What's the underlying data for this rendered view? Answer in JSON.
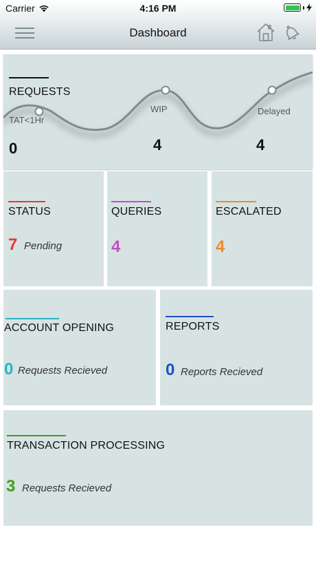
{
  "status_bar": {
    "carrier": "Carrier",
    "time": "4:16 PM"
  },
  "nav": {
    "title": "Dashboard",
    "menu_icon": "hamburger-menu-icon",
    "home_icon": "home-icon",
    "bell_icon": "bell-icon"
  },
  "requests": {
    "title": "REQUESTS",
    "stages": [
      {
        "label": "TAT<1Hr",
        "count": "0"
      },
      {
        "label": "WIP",
        "count": "4"
      },
      {
        "label": "Delayed",
        "count": "4"
      }
    ]
  },
  "status": {
    "title": "STATUS",
    "count": "7",
    "caption": "Pending",
    "accent": "#e53935"
  },
  "queries": {
    "title": "QUERIES",
    "count": "4",
    "accent": "#c24fc7"
  },
  "escalated": {
    "title": "ESCALATED",
    "count": "4",
    "accent": "#f08a24"
  },
  "account_opening": {
    "title": "ACCOUNT OPENING",
    "count": "0",
    "caption": "Requests Recieved",
    "accent": "#2bb3c0"
  },
  "reports": {
    "title": "REPORTS",
    "count": "0",
    "caption": "Reports Recieved",
    "accent": "#1d4fc4"
  },
  "transaction_processing": {
    "title": "TRANSACTION PROCESSING",
    "count": "3",
    "caption": "Requests Recieved",
    "accent": "#3e9d1b"
  }
}
